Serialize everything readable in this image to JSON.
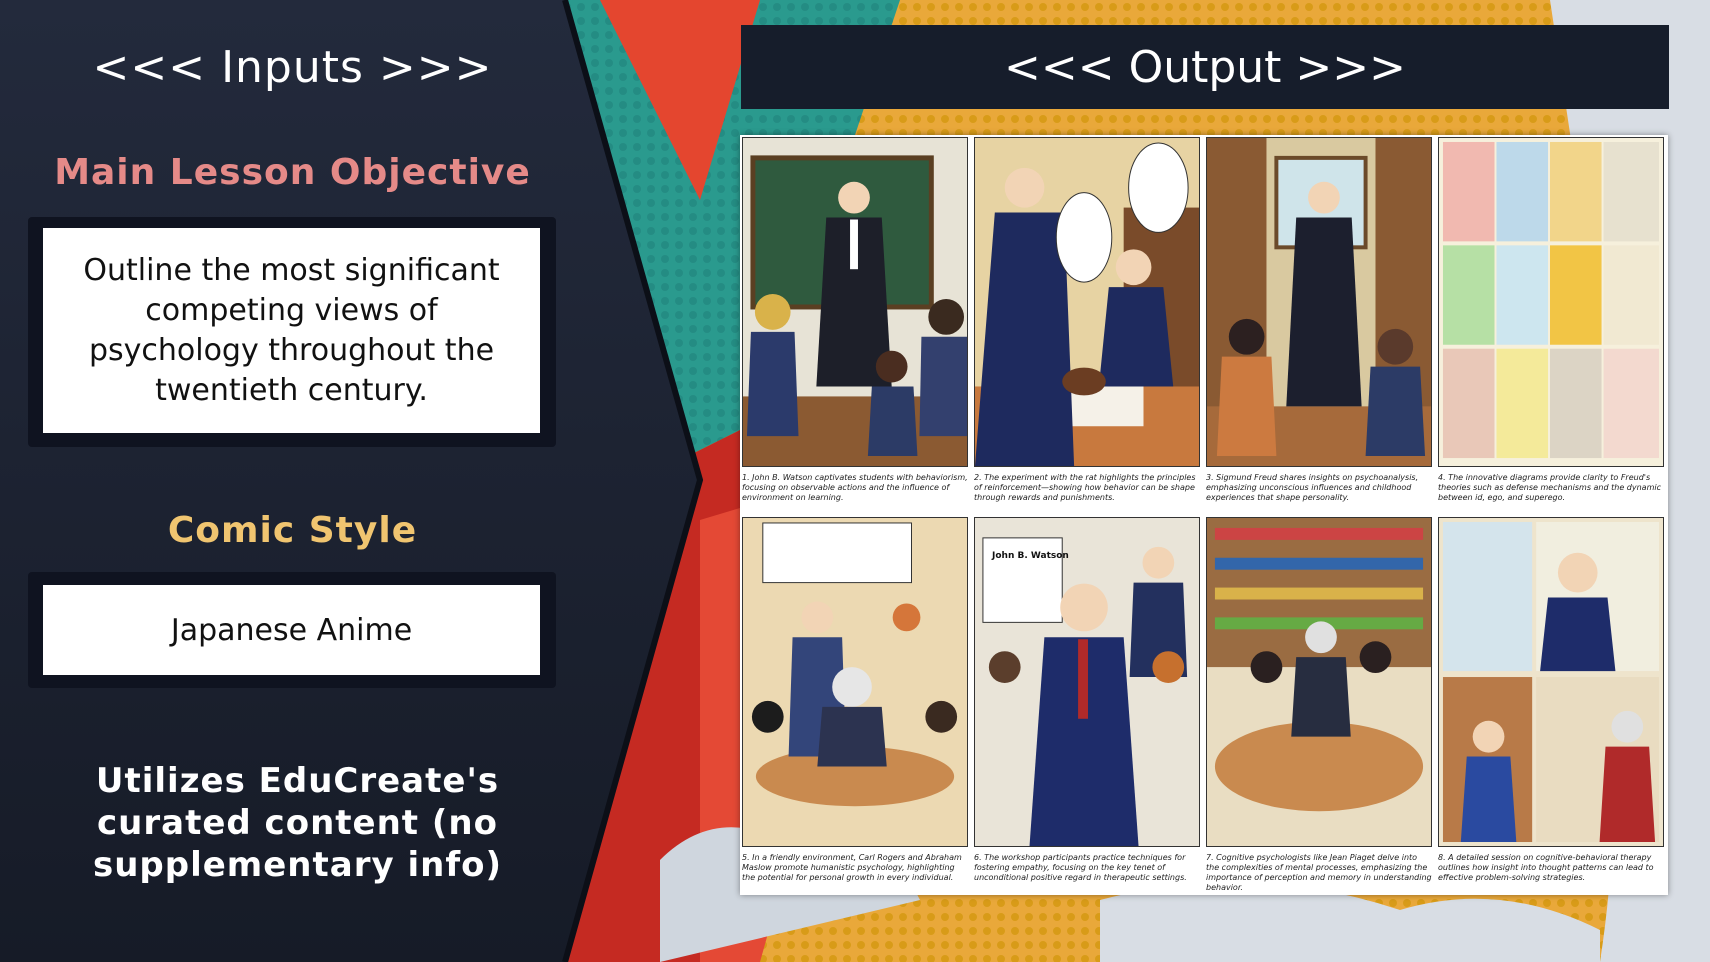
{
  "inputs": {
    "title": "<<< Inputs >>>",
    "objective_heading": "Main Lesson Objective",
    "objective_text": "Outline the most significant competing views of psychology throughout the twentieth century.",
    "style_heading": "Comic Style",
    "style_value": "Japanese Anime",
    "footer_note": "Utilizes EduCreate's curated content (no supplementary info)"
  },
  "output": {
    "title": "<<< Output >>>",
    "panels": [
      {
        "caption": "1. John B. Watson captivates students with behaviorism, focusing on observable actions and the influence of environment on learning."
      },
      {
        "caption": "2. The experiment with the rat highlights the principles of reinforcement—showing how behavior can be shape through rewards and punishments."
      },
      {
        "caption": "3. Sigmund Freud shares insights on psychoanalysis, emphasizing unconscious influences and childhood experiences that shape personality."
      },
      {
        "caption": "4. The innovative diagrams provide clarity to Freud's theories such as defense mechanisms and the dynamic between id, ego, and superego."
      },
      {
        "caption": "5. In a friendly environment, Carl Rogers and Abraham Maslow promote humanistic psychology, highlighting the potential for personal growth in every individual."
      },
      {
        "caption": "6. The workshop participants practice techniques for fostering empathy, focusing on the key tenet of unconditional positive regard in therapeutic settings."
      },
      {
        "caption": "7. Cognitive psychologists like Jean Piaget delve into the complexities of mental processes, emphasizing the importance of perception and memory in understanding behavior."
      },
      {
        "caption": "8. A detailed session on cognitive-behavioral therapy outlines how insight into thought patterns can lead to effective problem-solving strategies."
      }
    ],
    "panel6_sign": "John B. Watson"
  },
  "colors": {
    "left_bg": "#1b2130",
    "objective_heading": "#e58a88",
    "style_heading": "#f0c570",
    "output_bar": "#161d2b"
  }
}
